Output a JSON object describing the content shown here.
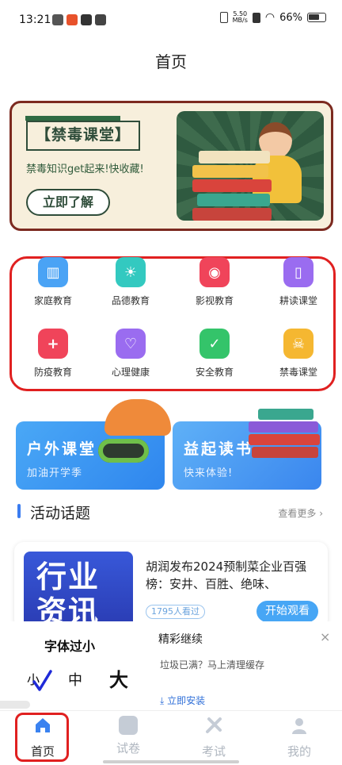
{
  "status_bar": {
    "time": "13:21",
    "speed_top": "5.50",
    "speed_unit": "MB/s",
    "battery": "66%"
  },
  "page": {
    "title": "首页"
  },
  "banner": {
    "tag": "【禁毒课堂】",
    "subtitle": "禁毒知识get起来!快收藏!",
    "button": "立即了解"
  },
  "categories": [
    {
      "label": "家庭教育",
      "icon": "file-cabinet-icon",
      "color": "#4aa3f5"
    },
    {
      "label": "品德教育",
      "icon": "lightbulb-icon",
      "color": "#33c9c0"
    },
    {
      "label": "影视教育",
      "icon": "film-reel-icon",
      "color": "#f0445a"
    },
    {
      "label": "耕读课堂",
      "icon": "book-icon",
      "color": "#9a6cf0"
    },
    {
      "label": "防疫教育",
      "icon": "shield-plus-icon",
      "color": "#f0445a"
    },
    {
      "label": "心理健康",
      "icon": "heartbeat-icon",
      "color": "#9a6cf0"
    },
    {
      "label": "安全教育",
      "icon": "shield-check-icon",
      "color": "#34c46a"
    },
    {
      "label": "禁毒课堂",
      "icon": "skull-icon",
      "color": "#f5b731"
    }
  ],
  "promos": [
    {
      "title": "户外课堂",
      "subtitle": "加油开学季",
      "color": "#4a9cf0"
    },
    {
      "title": "益起读书",
      "subtitle": "快来体验!",
      "color": "#3e8ff0"
    }
  ],
  "section": {
    "title": "活动话题",
    "more": "查看更多 ›"
  },
  "article": {
    "thumb_line1": "行业",
    "thumb_line2": "资讯",
    "title": "胡润发布2024预制菜企业百强榜：安井、百胜、绝味、",
    "views": "1795人看过",
    "button": "开始观看"
  },
  "overlay": {
    "font_hint": "字体过小",
    "size_small": "小",
    "size_mid": "中",
    "size_big": "大",
    "ad_title": "精彩继续",
    "ad_close": "×",
    "ad_desc": "垃圾已满？马上清理缓存",
    "ad_install": "⤓ 立即安装"
  },
  "nav": [
    {
      "label": "首页",
      "icon": "home-icon",
      "active": true
    },
    {
      "label": "试卷",
      "icon": "paper-icon",
      "active": false
    },
    {
      "label": "考试",
      "icon": "pencil-ruler-icon",
      "active": false
    },
    {
      "label": "我的",
      "icon": "user-icon",
      "active": false
    }
  ]
}
